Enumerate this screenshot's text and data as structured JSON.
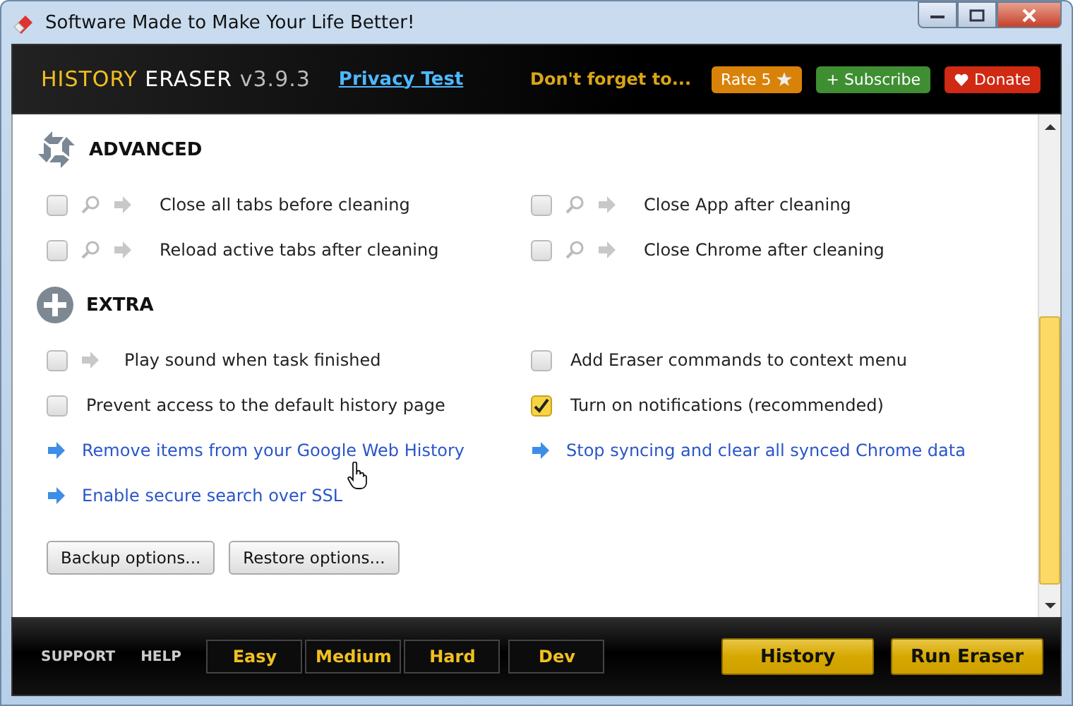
{
  "window": {
    "title": "Software Made to Make Your Life Better!"
  },
  "header": {
    "logo": [
      "HISTORY",
      "ERASER",
      "v3.9.3"
    ],
    "privacy_link": "Privacy Test",
    "reminder": "Don't forget to...",
    "buttons": [
      {
        "label": "Rate 5",
        "kind": "star",
        "color": "#d9820a"
      },
      {
        "label": "+ Subscribe",
        "kind": "plain",
        "color": "#3f8f32"
      },
      {
        "label": "Donate",
        "kind": "heart",
        "color": "#d02a14"
      }
    ]
  },
  "sections": [
    {
      "title": "ADVANCED",
      "kind": "cycle",
      "items": [
        {
          "label": "Close all tabs before cleaning",
          "kind": "search-check",
          "checked": false
        },
        {
          "label": "Close App after cleaning",
          "kind": "search-check",
          "checked": false
        },
        {
          "label": "Reload active tabs after cleaning",
          "kind": "search-check",
          "checked": false
        },
        {
          "label": "Close Chrome after cleaning",
          "kind": "search-check",
          "checked": false
        }
      ]
    },
    {
      "title": "EXTRA",
      "kind": "plus",
      "items": [
        {
          "label": "Play sound when task finished",
          "kind": "arrow-check",
          "checked": false
        },
        {
          "label": "Add Eraser commands to context menu",
          "kind": "check",
          "checked": false
        },
        {
          "label": "Prevent access to the default history page",
          "kind": "check",
          "checked": false
        },
        {
          "label": "Turn on notifications (recommended)",
          "kind": "check",
          "checked": true
        },
        {
          "label": "Remove items from your Google Web History",
          "kind": "link"
        },
        {
          "label": "Stop syncing and clear all synced Chrome data",
          "kind": "link"
        },
        {
          "label": "Enable secure search over SSL",
          "kind": "link"
        }
      ]
    }
  ],
  "option_buttons": [
    "Backup options...",
    "Restore options..."
  ],
  "footer": {
    "links": [
      "SUPPORT",
      "HELP"
    ],
    "modes": [
      "Easy",
      "Medium",
      "Hard",
      "Dev"
    ],
    "actions": [
      "History",
      "Run Eraser"
    ]
  }
}
